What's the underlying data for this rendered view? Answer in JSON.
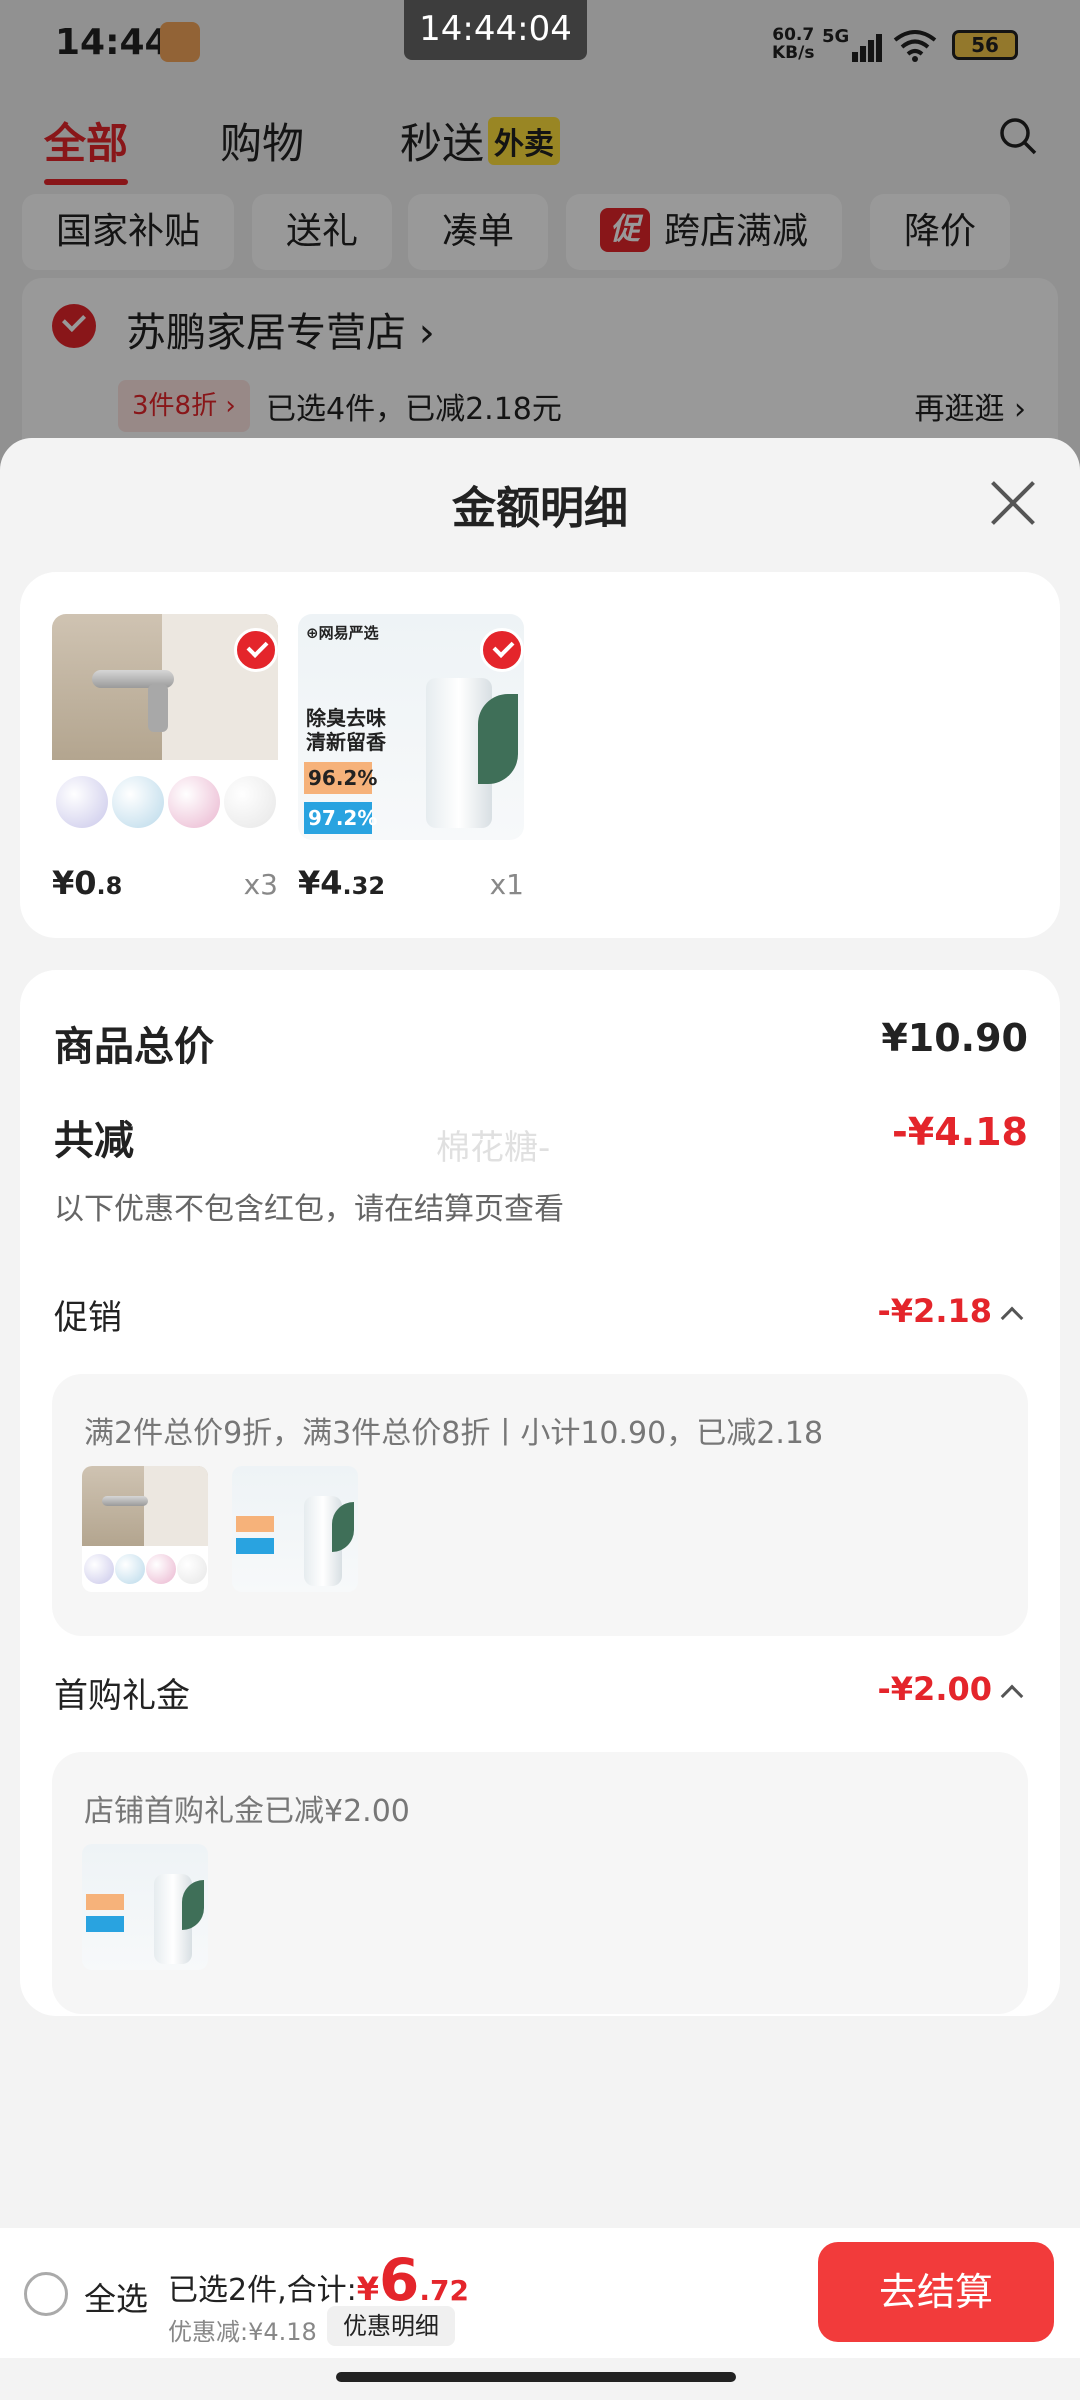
{
  "status_bar": {
    "time": "14:44",
    "clock": "14:44:04",
    "net_speed": "60.7",
    "net_unit": "KB/s",
    "network": "5G",
    "battery": "56"
  },
  "top_tabs": [
    {
      "label": "全部"
    },
    {
      "label": "购物"
    },
    {
      "label": "秒送",
      "badge": "外卖"
    }
  ],
  "filters": [
    {
      "label": "国家补贴"
    },
    {
      "label": "送礼"
    },
    {
      "label": "凑单"
    },
    {
      "label": "跨店满减",
      "tag": "促"
    },
    {
      "label": "降价"
    }
  ],
  "store": {
    "name": "苏鹏家居专营店",
    "promo_tag": "3件8折 ›",
    "promo_text": "已选4件，已减2.18元",
    "browse_more": "再逛逛 ›"
  },
  "sheet": {
    "title": "金额明细",
    "products": [
      {
        "price_main": "¥0",
        "price_decimal": ".8",
        "qty": "x3",
        "thumb": "door-stopper"
      },
      {
        "price_main": "¥4",
        "price_decimal": ".32",
        "qty": "x1",
        "thumb": "deodorizer-spray",
        "thumb_text": {
          "brand": "⊕网易严选",
          "headline1": "除臭去味",
          "headline2": "清新留香",
          "badge1": "96.2%",
          "badge2": "97.2%"
        }
      }
    ],
    "summary": {
      "total_label": "商品总价",
      "total_value": "¥10.90",
      "reduce_label": "共减",
      "reduce_value": "-¥4.18",
      "reduce_note": "以下优惠不包含红包，请在结算页查看",
      "watermark": "棉花糖-",
      "promo_label": "促销",
      "promo_value": "-¥2.18",
      "promo_detail": "满2件总价9折，满3件总价8折丨小计10.90，已减2.18",
      "gift_label": "首购礼金",
      "gift_value": "-¥2.00",
      "gift_detail": "店铺首购礼金已减¥2.00"
    }
  },
  "bottom_bar": {
    "select_all": "全选",
    "selected_summary": "已选2件,合计:",
    "currency": "¥",
    "total_int": "6",
    "total_dec": ".72",
    "discount_line": "优惠减:¥4.18",
    "detail_link": "优惠明细",
    "checkout": "去结算"
  },
  "colors": {
    "accent": "#e4252b",
    "checkout": "#f23b3b",
    "sheet_bg": "#f3f3f3"
  }
}
